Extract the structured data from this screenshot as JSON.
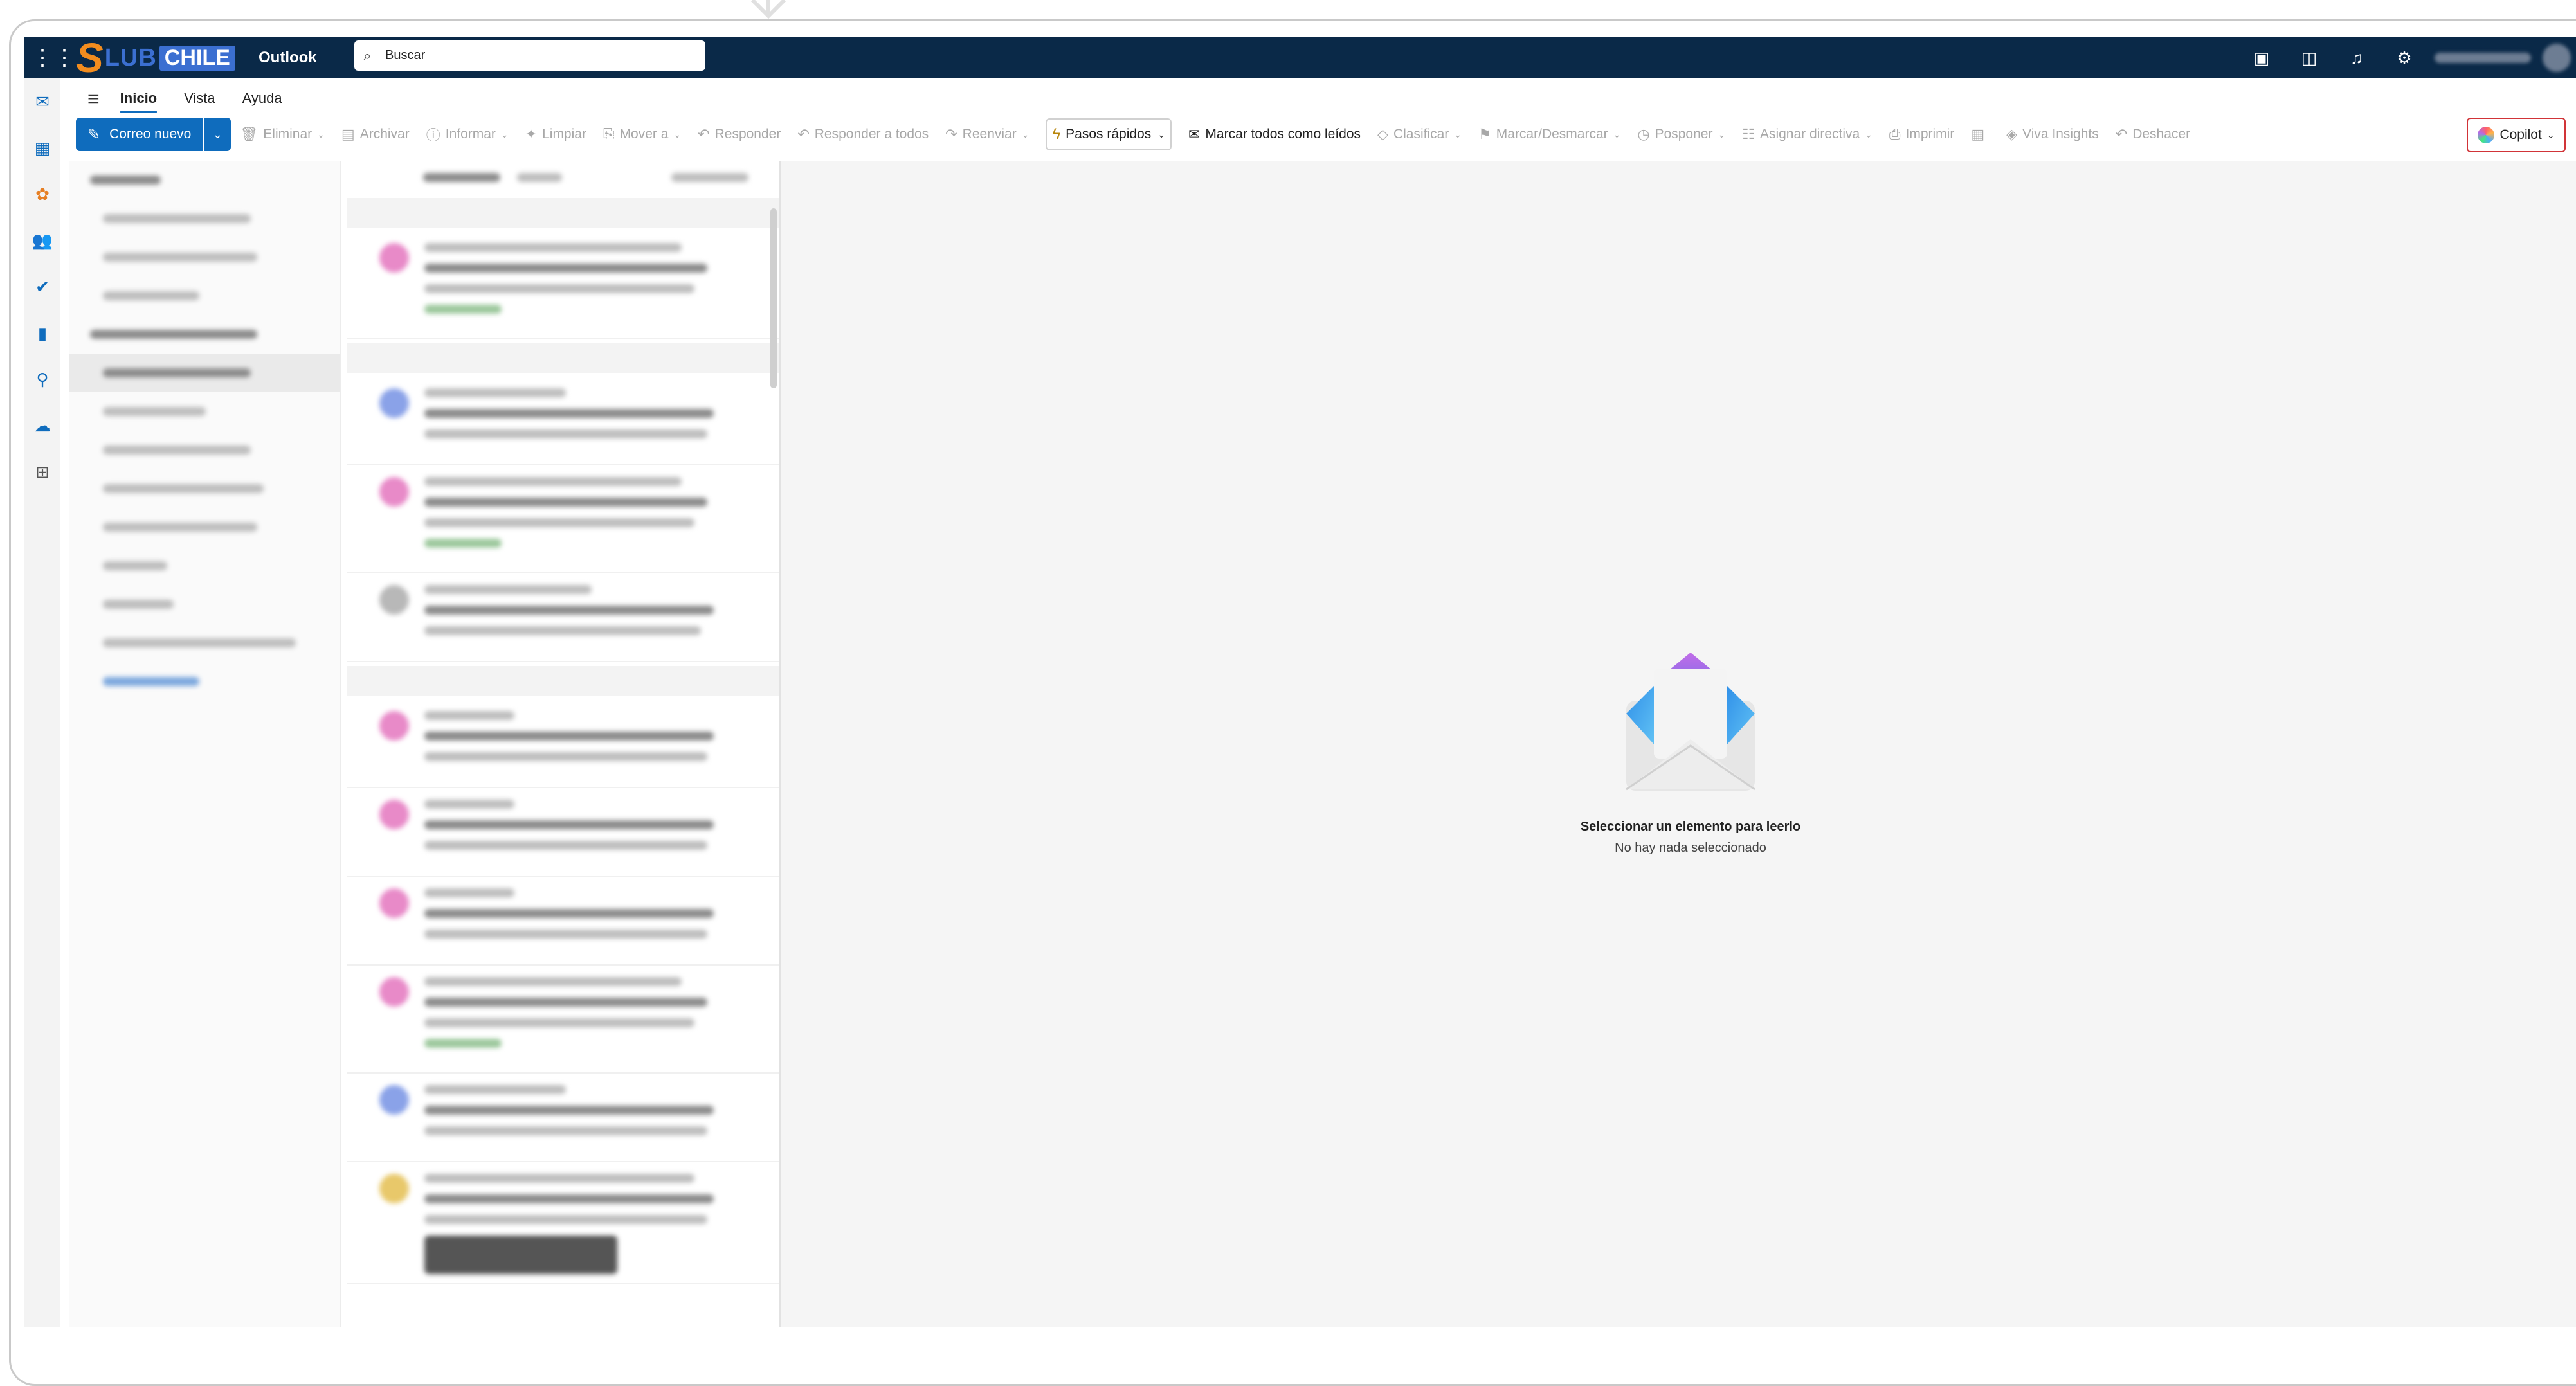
{
  "app": {
    "title": "Outlook",
    "brand_mark": "S",
    "brand_word_a": "LUB",
    "brand_word_b": "CHILE"
  },
  "search": {
    "placeholder": "Buscar",
    "icon": "search-icon"
  },
  "top_icons": [
    "meet-now-icon",
    "whats-new-icon",
    "bell-icon",
    "gear-icon"
  ],
  "tabs": [
    {
      "label": "Inicio",
      "active": true
    },
    {
      "label": "Vista",
      "active": false
    },
    {
      "label": "Ayuda",
      "active": false
    }
  ],
  "ribbon": {
    "new_mail": "Correo nuevo",
    "actions": [
      {
        "label": "Eliminar",
        "icon": "🗑",
        "enabled": false,
        "dropdown": true
      },
      {
        "label": "Archivar",
        "icon": "▤",
        "enabled": false,
        "dropdown": false
      },
      {
        "label": "Informar",
        "icon": "ⓘ",
        "enabled": false,
        "dropdown": true
      },
      {
        "label": "Limpiar",
        "icon": "✦",
        "enabled": false,
        "dropdown": false
      },
      {
        "label": "Mover a",
        "icon": "⎘",
        "enabled": false,
        "dropdown": true
      },
      {
        "label": "Responder",
        "icon": "↶",
        "enabled": false,
        "dropdown": false
      },
      {
        "label": "Responder a todos",
        "icon": "↶",
        "enabled": false,
        "dropdown": false
      },
      {
        "label": "Reenviar",
        "icon": "↷",
        "enabled": false,
        "dropdown": true
      }
    ],
    "quick_steps": "Pasos rápidos",
    "mark_all_read": "Marcar todos como leídos",
    "actions2": [
      {
        "label": "Clasificar",
        "icon": "◇",
        "enabled": false,
        "dropdown": true
      },
      {
        "label": "Marcar/Desmarcar",
        "icon": "⚑",
        "enabled": false,
        "dropdown": true
      },
      {
        "label": "Posponer",
        "icon": "◷",
        "enabled": false,
        "dropdown": true
      },
      {
        "label": "Asignar directiva",
        "icon": "☷",
        "enabled": false,
        "dropdown": true
      },
      {
        "label": "Imprimir",
        "icon": "⎙",
        "enabled": false,
        "dropdown": false
      },
      {
        "label": "",
        "icon": "▦",
        "enabled": false,
        "dropdown": false
      },
      {
        "label": "Viva Insights",
        "icon": "◈",
        "enabled": false,
        "dropdown": false
      },
      {
        "label": "Deshacer",
        "icon": "↶",
        "enabled": false,
        "dropdown": false
      }
    ],
    "copilot": "Copilot"
  },
  "reading_pane": {
    "empty_title": "Seleccionar un elemento para leerlo",
    "empty_subtitle": "No hay nada seleccionado"
  }
}
